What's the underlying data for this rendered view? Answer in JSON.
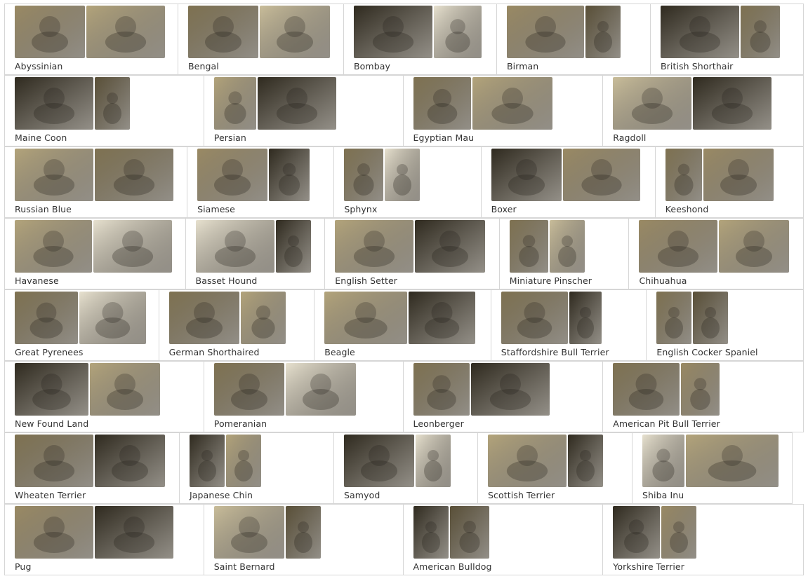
{
  "rows": [
    [
      {
        "label": "Abyssinian",
        "photos": [
          {
            "t": 0
          },
          {
            "t": 1
          }
        ]
      },
      {
        "label": "Bengal",
        "photos": [
          {
            "t": 2
          },
          {
            "t": 3
          }
        ]
      },
      {
        "label": "Bombay",
        "photos": [
          {
            "t": 4
          },
          {
            "t": 5
          }
        ]
      },
      {
        "label": "Birman",
        "photos": [
          {
            "t": 0
          },
          {
            "t": 6
          }
        ]
      },
      {
        "label": "British Shorthair",
        "photos": [
          {
            "t": 4
          },
          {
            "t": 2
          }
        ]
      }
    ],
    [
      {
        "label": "Maine Coon",
        "photos": [
          {
            "t": 4
          },
          {
            "t": 6
          }
        ]
      },
      {
        "label": "Persian",
        "photos": [
          {
            "t": 1
          },
          {
            "t": 4
          }
        ]
      },
      {
        "label": "Egyptian Mau",
        "photos": [
          {
            "t": 2
          },
          {
            "t": 1
          }
        ]
      },
      {
        "label": "Ragdoll",
        "photos": [
          {
            "t": 3
          },
          {
            "t": 4
          }
        ]
      }
    ],
    [
      {
        "label": "Russian Blue",
        "photos": [
          {
            "t": 1
          },
          {
            "t": 2
          }
        ]
      },
      {
        "label": "Siamese",
        "photos": [
          {
            "t": 0
          },
          {
            "t": 4
          }
        ]
      },
      {
        "label": "Sphynx",
        "photos": [
          {
            "t": 2
          },
          {
            "t": 5
          }
        ]
      },
      {
        "label": "Boxer",
        "photos": [
          {
            "t": 4
          },
          {
            "t": 0
          }
        ]
      },
      {
        "label": "Keeshond",
        "photos": [
          {
            "t": 2
          },
          {
            "t": 0
          }
        ]
      }
    ],
    [
      {
        "label": "Havanese",
        "photos": [
          {
            "t": 1
          },
          {
            "t": 5
          }
        ]
      },
      {
        "label": "Basset Hound",
        "photos": [
          {
            "t": 5
          },
          {
            "t": 4
          }
        ]
      },
      {
        "label": "English Setter",
        "photos": [
          {
            "t": 1
          },
          {
            "t": 4
          }
        ]
      },
      {
        "label": "Miniature Pinscher",
        "photos": [
          {
            "t": 2
          },
          {
            "t": 3
          }
        ]
      },
      {
        "label": "Chihuahua",
        "photos": [
          {
            "t": 0
          },
          {
            "t": 1
          }
        ]
      }
    ],
    [
      {
        "label": "Great Pyrenees",
        "photos": [
          {
            "t": 2
          },
          {
            "t": 5
          }
        ]
      },
      {
        "label": "German Shorthaired",
        "photos": [
          {
            "t": 2
          },
          {
            "t": 1
          }
        ]
      },
      {
        "label": "Beagle",
        "photos": [
          {
            "t": 1
          },
          {
            "t": 4
          }
        ]
      },
      {
        "label": "Staffordshire Bull Terrier",
        "photos": [
          {
            "t": 2
          },
          {
            "t": 4
          }
        ]
      },
      {
        "label": "English Cocker Spaniel",
        "photos": [
          {
            "t": 2
          },
          {
            "t": 6
          }
        ]
      }
    ],
    [
      {
        "label": "New Found Land",
        "photos": [
          {
            "t": 4
          },
          {
            "t": 1
          }
        ]
      },
      {
        "label": "Pomeranian",
        "photos": [
          {
            "t": 2
          },
          {
            "t": 5
          }
        ]
      },
      {
        "label": "Leonberger",
        "photos": [
          {
            "t": 2
          },
          {
            "t": 4
          }
        ]
      },
      {
        "label": "American Pit Bull Terrier",
        "photos": [
          {
            "t": 2
          },
          {
            "t": 0
          }
        ]
      }
    ],
    [
      {
        "label": "Wheaten Terrier",
        "photos": [
          {
            "t": 2
          },
          {
            "t": 4
          }
        ]
      },
      {
        "label": "Japanese Chin",
        "photos": [
          {
            "t": 4
          },
          {
            "t": 1
          }
        ]
      },
      {
        "label": "Samyod",
        "photos": [
          {
            "t": 4
          },
          {
            "t": 5
          }
        ]
      },
      {
        "label": "Scottish Terrier",
        "photos": [
          {
            "t": 1
          },
          {
            "t": 4
          }
        ]
      },
      {
        "label": "Shiba Inu",
        "photos": [
          {
            "t": 5
          },
          {
            "t": 1
          }
        ]
      }
    ],
    [
      {
        "label": "Pug",
        "photos": [
          {
            "t": 0
          },
          {
            "t": 4
          }
        ]
      },
      {
        "label": "Saint Bernard",
        "photos": [
          {
            "t": 3
          },
          {
            "t": 6
          }
        ]
      },
      {
        "label": "American Bulldog",
        "photos": [
          {
            "t": 4
          },
          {
            "t": 6
          }
        ]
      },
      {
        "label": "Yorkshire Terrier",
        "photos": [
          {
            "t": 4
          },
          {
            "t": 0
          }
        ]
      }
    ]
  ],
  "photo_tones": [
    "#9a8a64",
    "#b3a47b",
    "#7f7251",
    "#c9bd9a",
    "#2f2a1f",
    "#e7e1cf",
    "#5a5038"
  ]
}
